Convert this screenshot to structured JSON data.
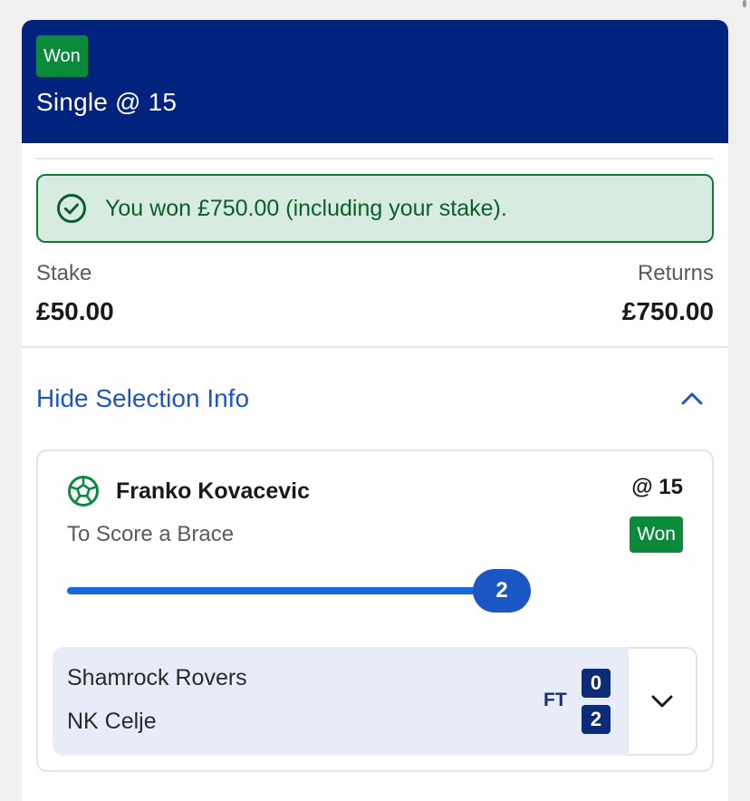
{
  "bet": {
    "status_badge": "Won",
    "title": "Single @ 15"
  },
  "result_banner": {
    "text": "You won £750.00 (including your stake)."
  },
  "summary": {
    "stake_label": "Stake",
    "stake_value": "£50.00",
    "returns_label": "Returns",
    "returns_value": "£750.00"
  },
  "selection_toggle": {
    "label": "Hide Selection Info"
  },
  "selection": {
    "player": "Franko Kovacevic",
    "odds": "@ 15",
    "market": "To Score a Brace",
    "status_badge": "Won",
    "progress_value": "2",
    "progress_fraction": 1.0
  },
  "match": {
    "home_team": "Shamrock Rovers",
    "away_team": "NK Celje",
    "status": "FT",
    "home_score": "0",
    "away_score": "2"
  },
  "icons": {
    "banner_icon": "check-circle-icon",
    "toggle_icon": "chevron-up-icon",
    "sport_icon": "football-icon",
    "expand_icon": "chevron-down-icon"
  },
  "colors": {
    "header_bg": "#00247d",
    "won_green": "#0b8a3c",
    "banner_bg": "#d7ecdf",
    "link_blue": "#1a56c4",
    "match_bg": "#e7ecf8",
    "score_bg": "#0c2b7a"
  }
}
